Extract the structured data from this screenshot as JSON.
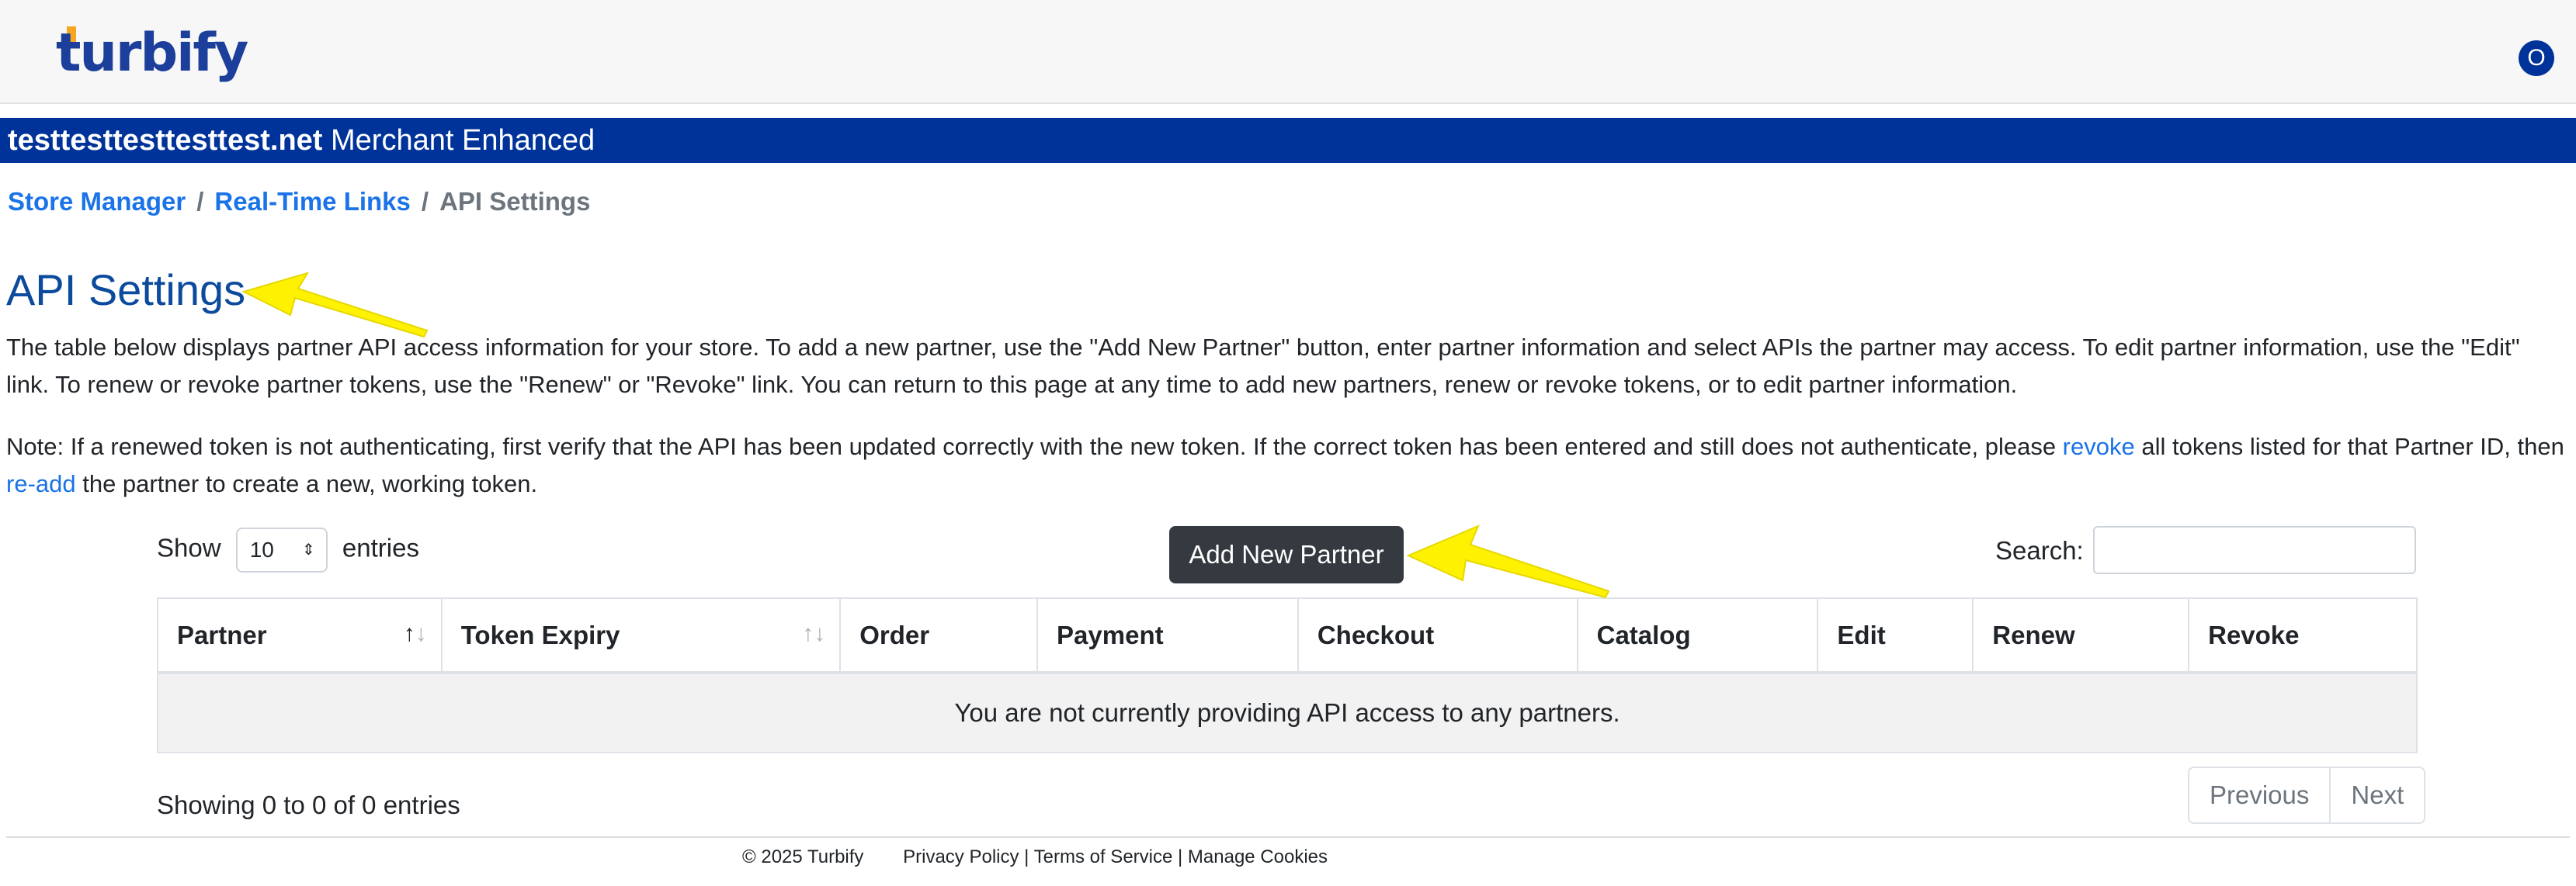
{
  "header": {
    "logo_text": "turbify",
    "avatar_initial": "O"
  },
  "store_bar": {
    "domain": "testtesttesttesttest.net",
    "plan": "Merchant Enhanced"
  },
  "breadcrumb": {
    "items": [
      "Store Manager",
      "Real-Time Links",
      "API Settings"
    ],
    "separator": "/"
  },
  "page": {
    "title": "API Settings",
    "intro": "The table below displays partner API access information for your store. To add a new partner, use the \"Add New Partner\" button, enter partner information and select APIs the partner may access. To edit partner information, use the \"Edit\" link. To renew or revoke partner tokens, use the \"Renew\" or \"Revoke\" link. You can return to this page at any time to add new partners, renew or revoke tokens, or to edit partner information.",
    "note_part1": "Note: If a renewed token is not authenticating, first verify that the API has been updated correctly with the new token. If the correct token has been entered and still does not authenticate, please ",
    "note_link1": "revoke",
    "note_part2": " all tokens listed for that Partner ID, then ",
    "note_link2": "re-add",
    "note_part3": " the partner to create a new, working token."
  },
  "table_controls": {
    "show_label": "Show",
    "entries_label": "entries",
    "page_size": "10",
    "add_button_label": "Add New Partner",
    "search_label": "Search:",
    "search_value": ""
  },
  "table": {
    "columns": [
      "Partner",
      "Token Expiry",
      "Order",
      "Payment",
      "Checkout",
      "Catalog",
      "Edit",
      "Renew",
      "Revoke"
    ],
    "empty_message": "You are not currently providing API access to any partners."
  },
  "pagination": {
    "info": "Showing 0 to 0 of 0 entries",
    "previous_label": "Previous",
    "next_label": "Next"
  },
  "footer": {
    "copyright": "© 2025 Turbify",
    "privacy": "Privacy Policy",
    "terms": "Terms of Service",
    "cookies": "Manage Cookies",
    "divider": "|"
  },
  "colors": {
    "brand_blue": "#003399",
    "link_blue": "#1a73e8",
    "title_blue": "#0b4a9c",
    "button_dark": "#343a40",
    "annotation_yellow": "#fff200"
  }
}
